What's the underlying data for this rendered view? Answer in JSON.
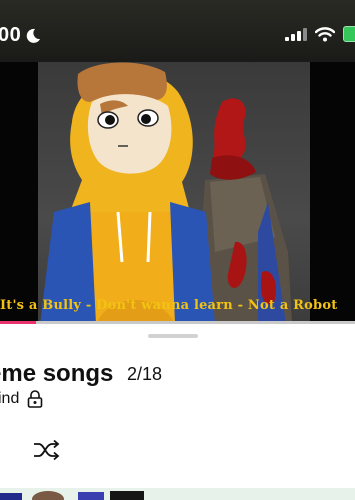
{
  "status_bar": {
    "time": "00",
    "moon_icon": "moon-icon",
    "signal_icon": "cellular-signal-icon",
    "wifi_icon": "wifi-icon",
    "battery_icon": "battery-icon"
  },
  "artwork": {
    "scrolling_text": "It's a Bully - Don't wanna learn - Not a Robot",
    "progress_fraction": 0.1
  },
  "playlist": {
    "title": "eme songs",
    "track_position": "2/18",
    "subtitle": "ind",
    "lock_icon": "lock-icon",
    "shuffle_icon": "shuffle-icon"
  },
  "colors": {
    "marquee_text": "#f2c313",
    "progress_accent": "#e8336c",
    "battery": "#35c759"
  }
}
